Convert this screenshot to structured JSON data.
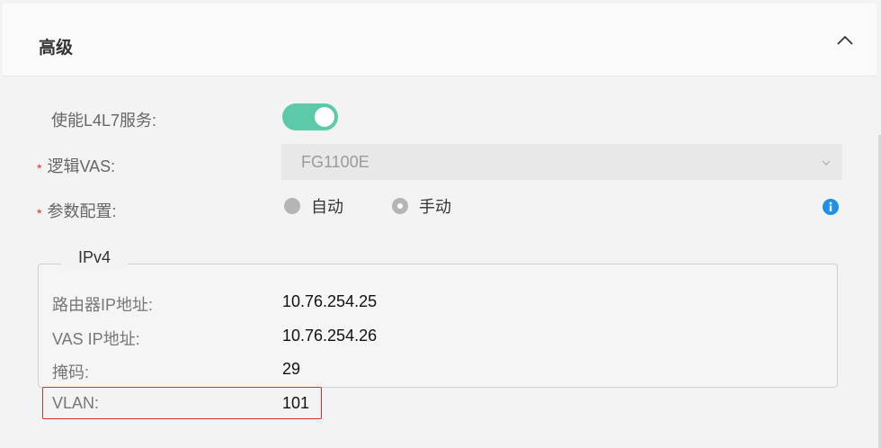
{
  "panel": {
    "title": "高级"
  },
  "form": {
    "l4l7": {
      "label": "使能L4L7服务:",
      "enabled": true
    },
    "logical_vas": {
      "required_mark": "*",
      "label": "逻辑VAS:",
      "value": "FG1100E"
    },
    "param_config": {
      "required_mark": "*",
      "label": "参数配置:",
      "options": [
        {
          "label": "自动",
          "selected": false
        },
        {
          "label": "手动",
          "selected": true
        }
      ]
    }
  },
  "ipv4": {
    "legend": "IPv4",
    "router_ip": {
      "label": "路由器IP地址:",
      "value": "10.76.254.25"
    },
    "vas_ip": {
      "label": "VAS IP地址:",
      "value": "10.76.254.26"
    },
    "mask": {
      "label": "掩码:",
      "value": "29"
    },
    "vlan": {
      "label": "VLAN:",
      "value": "101"
    }
  },
  "colors": {
    "toggle_on": "#5ccaa8",
    "info": "#1e90e8",
    "highlight": "#d03030"
  }
}
